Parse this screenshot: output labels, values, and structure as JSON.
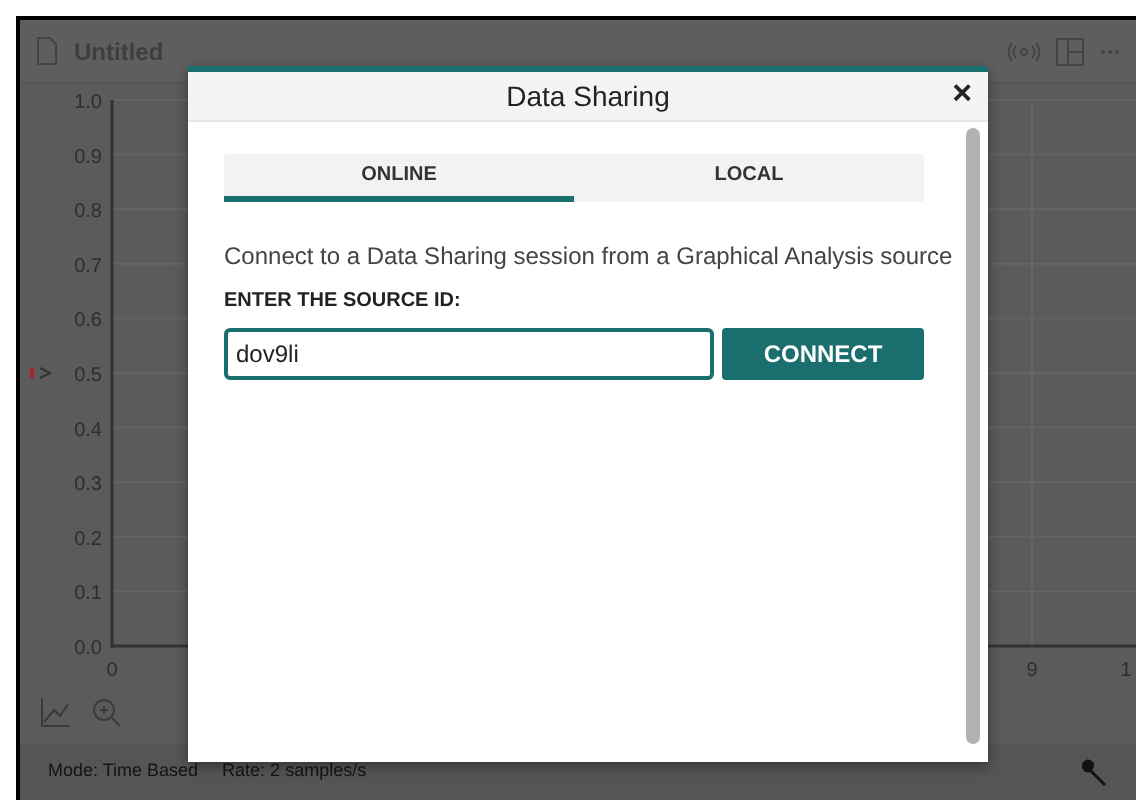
{
  "app": {
    "document_title": "Untitled"
  },
  "graph": {
    "y_tick_labels": [
      "1.0",
      "0.9",
      "0.8",
      "0.7",
      "0.6",
      "0.5",
      "0.4",
      "0.3",
      "0.2",
      "0.1",
      "0.0"
    ],
    "x_tick_labels": [
      "0",
      "9",
      "1"
    ]
  },
  "status_bar": {
    "mode": "Mode: Time Based",
    "rate": "Rate: 2 samples/s"
  },
  "dialog": {
    "title": "Data Sharing",
    "close": "×",
    "tabs": [
      {
        "label": "ONLINE",
        "selected": true
      },
      {
        "label": "LOCAL",
        "selected": false
      }
    ],
    "description": "Connect to a Data Sharing session from a Graphical Analysis source",
    "field_label": "ENTER THE SOURCE ID:",
    "source_id": {
      "value": "dov9li"
    },
    "connect_button": "CONNECT"
  }
}
